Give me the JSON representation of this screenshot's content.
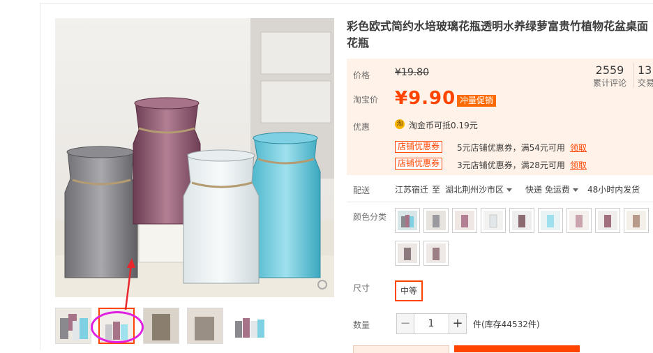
{
  "product": {
    "title": "彩色欧式简约水培玻璃花瓶透明水养绿萝富贵竹植物花盆桌面花瓶"
  },
  "price": {
    "label": "价格",
    "original": "¥19.80",
    "taobao_label": "淘宝价",
    "current": "¥9.90",
    "promo": "冲量促销"
  },
  "stats": {
    "reviews_count": "2559",
    "reviews_label": "累计评论",
    "trades_count": "13",
    "trades_label": "交易"
  },
  "promotions": {
    "label": "优惠",
    "coin_icon": "淘",
    "coin_text": "淘金币可抵0.19元",
    "coupons": [
      {
        "tag": "店铺优惠券",
        "text": "5元店铺优惠券，满54元可用",
        "link": "领取"
      },
      {
        "tag": "店铺优惠券",
        "text": "3元店铺优惠券，满28元可用",
        "link": "领取"
      }
    ]
  },
  "shipping": {
    "label": "配送",
    "from": "江苏宿迁",
    "to_word": "至",
    "destination": "湖北荆州沙市区",
    "method": "快递 免运费",
    "eta": "48小时内发货"
  },
  "sku": {
    "color_label": "颜色分类",
    "size_label": "尺寸",
    "size_selected": "中等"
  },
  "quantity": {
    "label": "数量",
    "minus": "−",
    "value": "1",
    "plus": "+",
    "stock": "件(库存44532件)"
  },
  "colors": {
    "accent": "#ff4400",
    "panel_bg": "#fff2e8",
    "annotation": "#e020e0"
  }
}
